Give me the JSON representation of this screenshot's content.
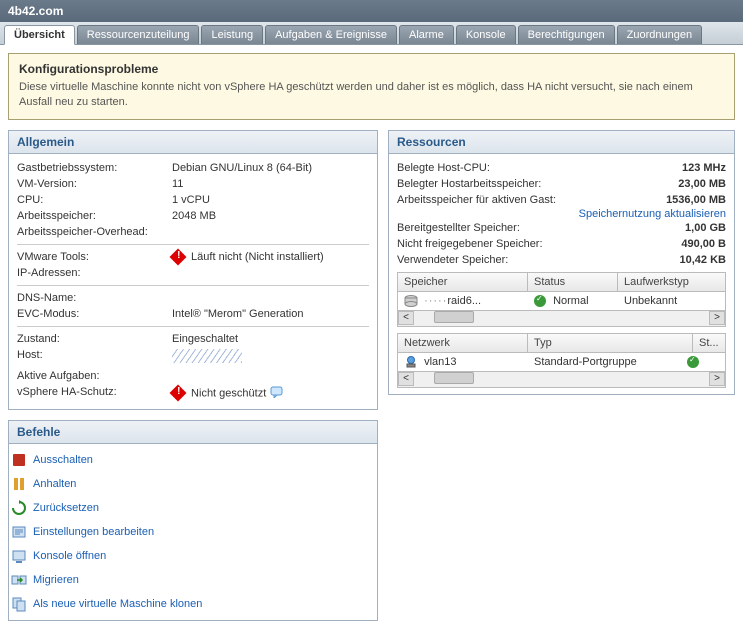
{
  "title": "4b42.com",
  "tabs": [
    "Übersicht",
    "Ressourcenzuteilung",
    "Leistung",
    "Aufgaben & Ereignisse",
    "Alarme",
    "Konsole",
    "Berechtigungen",
    "Zuordnungen"
  ],
  "alert": {
    "title": "Konfigurationsprobleme",
    "text": "Diese virtuelle Maschine konnte nicht von vSphere HA geschützt werden und daher ist es möglich, dass HA nicht versucht, sie nach einem Ausfall neu zu starten."
  },
  "general": {
    "header": "Allgemein",
    "rows1": [
      {
        "k": "Gastbetriebssystem:",
        "v": "Debian GNU/Linux 8 (64-Bit)"
      },
      {
        "k": "VM-Version:",
        "v": "11"
      },
      {
        "k": "CPU:",
        "v": "1 vCPU"
      },
      {
        "k": "Arbeitsspeicher:",
        "v": "2048 MB"
      },
      {
        "k": "Arbeitsspeicher-Overhead:",
        "v": ""
      }
    ],
    "rows2": [
      {
        "k": "VMware Tools:",
        "v": "Läuft nicht (Nicht installiert)",
        "warn": true
      },
      {
        "k": "IP-Adressen:",
        "v": ""
      }
    ],
    "rows3": [
      {
        "k": "DNS-Name:",
        "v": ""
      },
      {
        "k": "EVC-Modus:",
        "v": "Intel® \"Merom\" Generation"
      }
    ],
    "rows4": [
      {
        "k": "Zustand:",
        "v": "Eingeschaltet"
      },
      {
        "k": "Host:",
        "v": "",
        "scribble": true
      },
      {
        "k": "Aktive Aufgaben:",
        "v": ""
      },
      {
        "k": "vSphere HA-Schutz:",
        "v": "Nicht geschützt",
        "warn": true,
        "bubble": true
      }
    ]
  },
  "commands": {
    "header": "Befehle",
    "items": [
      {
        "label": "Ausschalten",
        "color": "#c03020",
        "icon": "power"
      },
      {
        "label": "Anhalten",
        "color": "#e0a030",
        "icon": "pause"
      },
      {
        "label": "Zurücksetzen",
        "color": "#2a8a2a",
        "icon": "reset"
      },
      {
        "label": "Einstellungen bearbeiten",
        "color": "#3a6aa0",
        "icon": "settings"
      },
      {
        "label": "Konsole öffnen",
        "color": "#3a6aa0",
        "icon": "console"
      },
      {
        "label": "Migrieren",
        "color": "#3a6aa0",
        "icon": "migrate"
      },
      {
        "label": "Als neue virtuelle Maschine klonen",
        "color": "#3a6aa0",
        "icon": "clone"
      }
    ]
  },
  "resources": {
    "header": "Ressourcen",
    "rows1": [
      {
        "k": "Belegte Host-CPU:",
        "v": "123 MHz"
      },
      {
        "k": "Belegter Hostarbeitsspeicher:",
        "v": "23,00 MB"
      },
      {
        "k": "Arbeitsspeicher für aktiven Gast:",
        "v": "1536,00 MB"
      }
    ],
    "refresh_link": "Speichernutzung aktualisieren",
    "rows2": [
      {
        "k": "Bereitgestellter Speicher:",
        "v": "1,00 GB"
      },
      {
        "k": "Nicht freigegebener Speicher:",
        "v": "490,00 B"
      },
      {
        "k": "Verwendeter Speicher:",
        "v": "10,42 KB"
      }
    ],
    "storage_grid": {
      "headers": [
        "Speicher",
        "Status",
        "Laufwerkstyp"
      ],
      "row": {
        "name": "raid6...",
        "status": "Normal",
        "type": "Unbekannt"
      }
    },
    "network_grid": {
      "headers": [
        "Netzwerk",
        "Typ",
        "St..."
      ],
      "row": {
        "name": "vlan13",
        "type": "Standard-Portgruppe"
      }
    }
  }
}
